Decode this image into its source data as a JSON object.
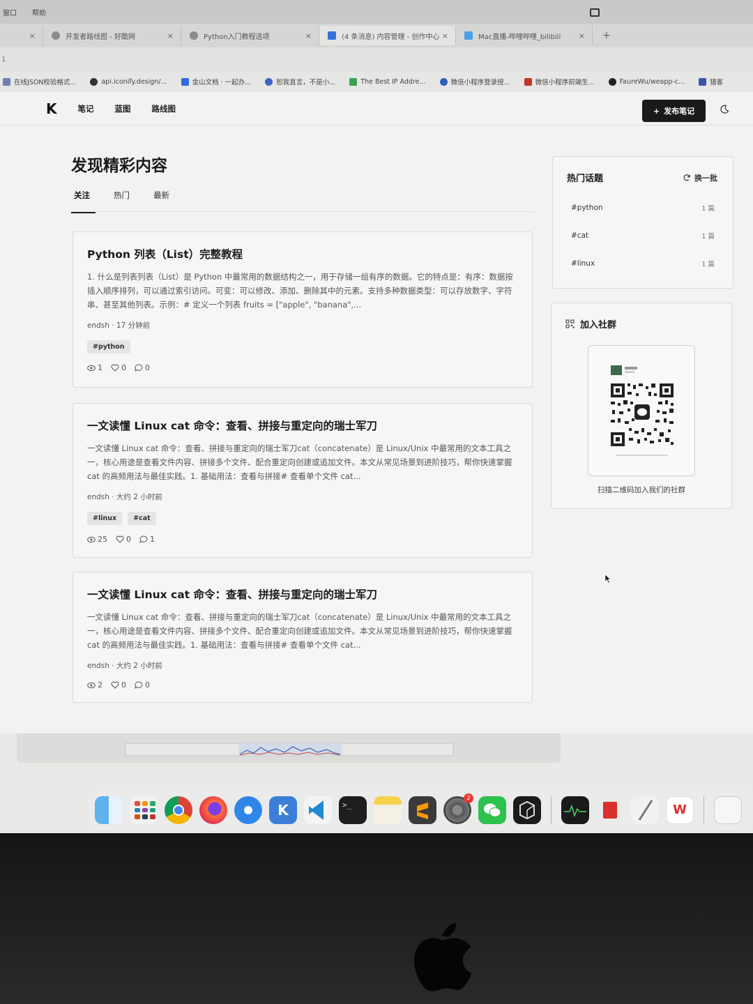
{
  "menubar": {
    "items": [
      "窗口",
      "帮助"
    ]
  },
  "tabs": [
    {
      "label": "开发者路线图 - 好酷网"
    },
    {
      "label": "Python入门教程选项"
    },
    {
      "label": "(4 条消息) 内容管理 - 创作中心"
    },
    {
      "label": "Mac直播-哔哩哔哩_bilibili"
    }
  ],
  "tab_new": "+",
  "address": "1",
  "bookmarks": [
    "在线JSON校验格式...",
    "api.iconify.design/...",
    "金山文档 · 一起办...",
    "恕我直言，不是小...",
    "The Best IP Addre...",
    "微信小程序登录授...",
    "微信小程序前端生...",
    "FaureWu/weapp-c...",
    "猎客"
  ],
  "site": {
    "logo": "K",
    "nav": [
      "笔记",
      "蓝图",
      "路线图"
    ],
    "publish_label": "发布笔记",
    "page_title": "发现精彩内容",
    "feed_tabs": [
      "关注",
      "热门",
      "最新"
    ]
  },
  "posts": [
    {
      "title": "Python 列表（List）完整教程",
      "excerpt": "1. 什么是列表列表（List）是 Python 中最常用的数据结构之一，用于存储一组有序的数据。它的特点是：有序：数据按插入顺序排列，可以通过索引访问。可变：可以修改、添加、删除其中的元素。支持多种数据类型：可以存放数字、字符串、甚至其他列表。示例：# 定义一个列表 fruits = [\"apple\", \"banana\",...",
      "author": "endsh",
      "time": "17 分钟前",
      "tags": [
        "#python"
      ],
      "views": "1",
      "likes": "0",
      "comments": "0"
    },
    {
      "title": "一文读懂 Linux cat 命令：查看、拼接与重定向的瑞士军刀",
      "excerpt": "一文读懂 Linux cat 命令：查看、拼接与重定向的瑞士军刀cat（concatenate）是 Linux/Unix 中最常用的文本工具之一，核心用途是查看文件内容、拼接多个文件、配合重定向创建或追加文件。本文从常见场景到进阶技巧，帮你快速掌握 cat 的高频用法与最佳实践。1. 基础用法：查看与拼接# 查看单个文件 cat...",
      "author": "endsh",
      "time": "大约 2 小时前",
      "tags": [
        "#linux",
        "#cat"
      ],
      "views": "25",
      "likes": "0",
      "comments": "1"
    },
    {
      "title": "一文读懂 Linux cat 命令：查看、拼接与重定向的瑞士军刀",
      "excerpt": "一文读懂 Linux cat 命令：查看、拼接与重定向的瑞士军刀cat（concatenate）是 Linux/Unix 中最常用的文本工具之一，核心用途是查看文件内容、拼接多个文件、配合重定向创建或追加文件。本文从常见场景到进阶技巧，帮你快速掌握 cat 的高频用法与最佳实践。1. 基础用法：查看与拼接# 查看单个文件 cat...",
      "author": "endsh",
      "time": "大约 2 小时前",
      "tags": [],
      "views": "2",
      "likes": "0",
      "comments": "0"
    }
  ],
  "hot_topics": {
    "title": "热门话题",
    "refresh_label": "换一批",
    "items": [
      {
        "name": "#python",
        "count": "1 篇"
      },
      {
        "name": "#cat",
        "count": "1 篇"
      },
      {
        "name": "#linux",
        "count": "1 篇"
      }
    ]
  },
  "community": {
    "title": "加入社群",
    "caption": "扫描二维码加入我们的社群"
  },
  "dock": {
    "apps": [
      "finder-icon",
      "launchpad-icon",
      "chrome-icon",
      "firefox-icon",
      "safari-icon",
      "k-app-icon",
      "vscode-icon",
      "terminal-icon",
      "notes-icon",
      "sublime-icon",
      "system-settings-icon",
      "wechat-icon",
      "cursor-app-icon",
      "activity-monitor-icon",
      "app-red-icon",
      "textedit-icon",
      "wps-icon",
      "document-icon"
    ],
    "settings_badge": "2"
  },
  "colors": {
    "accent": "#1a1a1a",
    "page_bg": "#f2f2f1",
    "card_bg": "#f6f6f5"
  }
}
